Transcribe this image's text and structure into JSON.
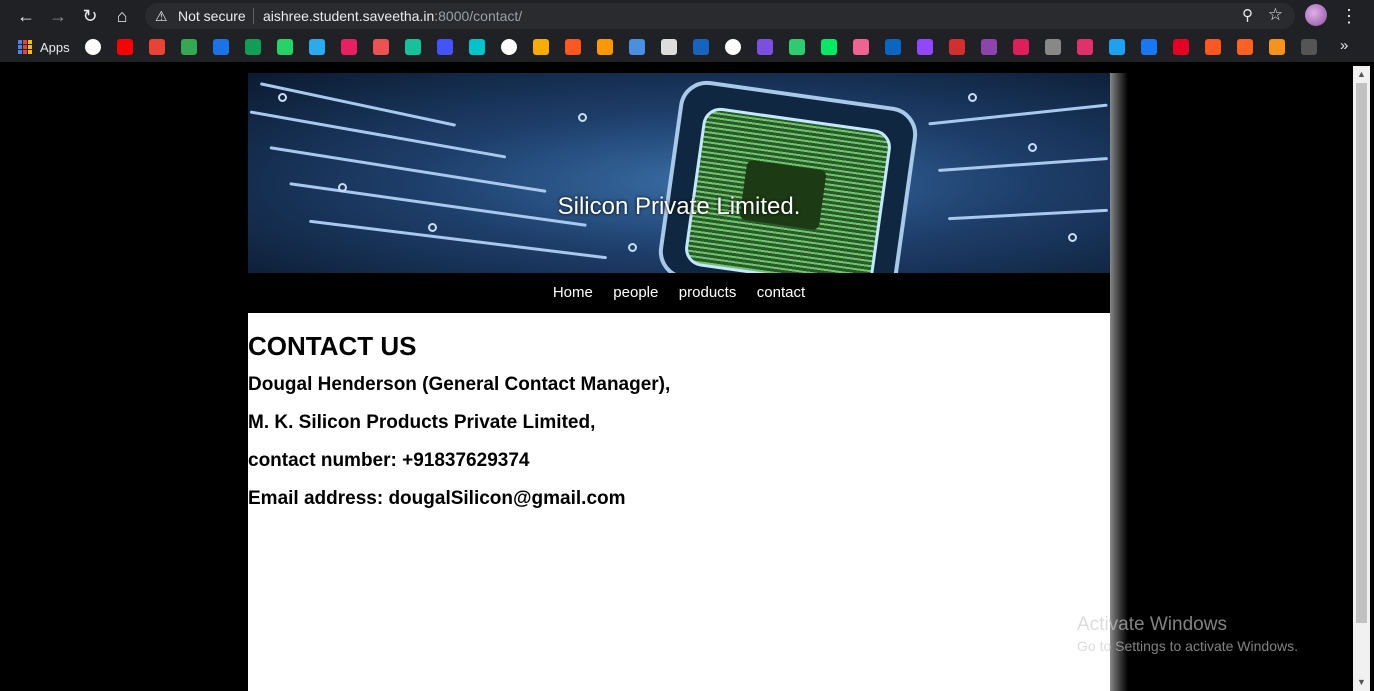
{
  "browser": {
    "address_bar": {
      "security_label": "Not secure",
      "url_host": "aishree.student.saveetha.in",
      "url_rest": ":8000/contact/"
    },
    "bookmarks": {
      "apps_label": "Apps",
      "icons": [
        "google",
        "youtube",
        "gmail",
        "drive",
        "meet",
        "chat",
        "whatsapp",
        "telegram",
        "medium",
        "udemy",
        "grammarly",
        "webflow",
        "canva",
        "expo",
        "google-analytics",
        "stackshare",
        "package",
        "klenty",
        "charts",
        "video",
        "x",
        "heart",
        "code",
        "hackerrank",
        "team",
        "linkedin",
        "twitch",
        "calendar",
        "podcast",
        "slack",
        "barcode",
        "instagram",
        "twitter",
        "facebook",
        "pinterest",
        "blogger",
        "wattpad",
        "bitcoin",
        "github"
      ]
    }
  },
  "page": {
    "banner_title": "Silicon Private Limited.",
    "nav": [
      "Home",
      "people",
      "products",
      "contact"
    ],
    "heading": "CONTACT US",
    "lines": [
      "Dougal Henderson (General Contact Manager),",
      "M. K. Silicon Products Private Limited,",
      "contact number: +91837629374",
      "Email address: dougalSilicon@gmail.com"
    ]
  },
  "watermark": {
    "title": "Activate Windows",
    "subtitle": "Go to Settings to activate Windows."
  },
  "colors": {
    "toolbar_bg": "#202124",
    "page_bg": "#ffffff",
    "nav_bg": "#000000"
  }
}
